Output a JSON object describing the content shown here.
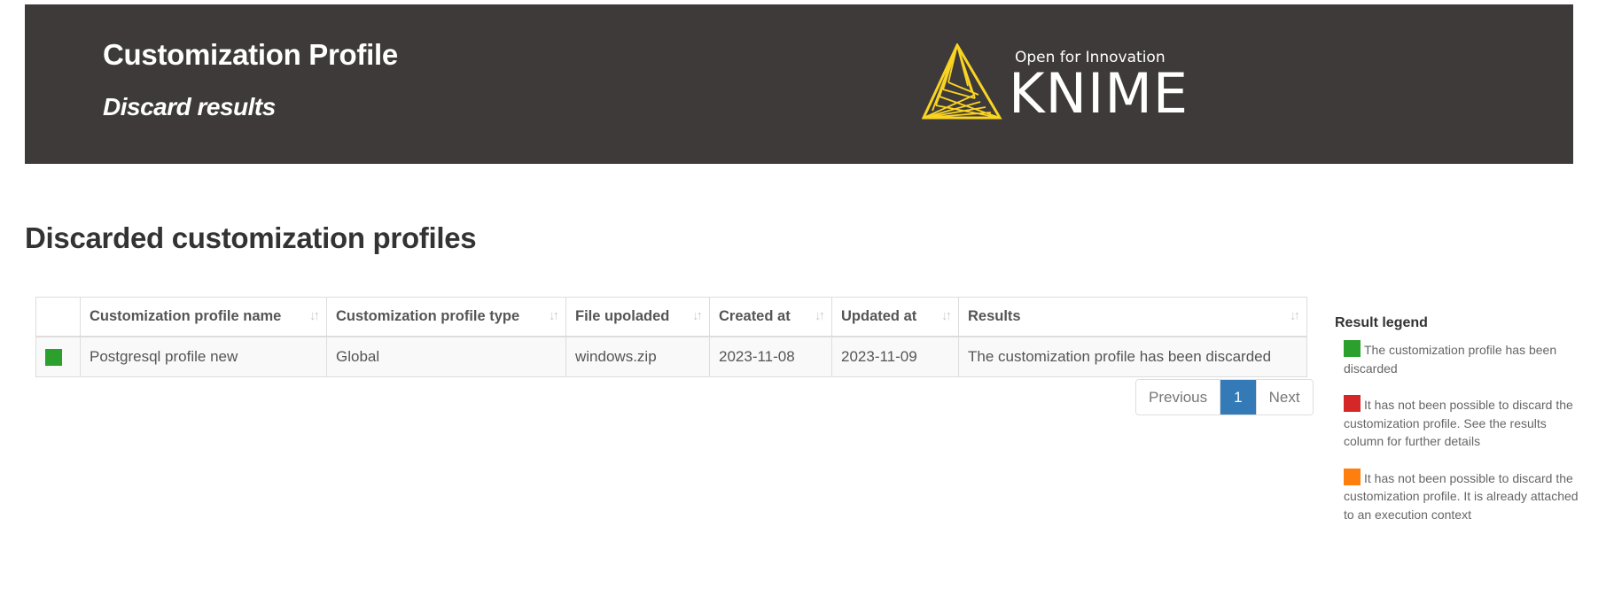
{
  "header": {
    "title": "Customization Profile",
    "subtitle": "Discard results",
    "logo": {
      "tagline": "Open for Innovation",
      "wordmark": "KNIME",
      "icon": "knime-triangle-icon",
      "accent_color": "#f9d423"
    },
    "background_color": "#3e3a39"
  },
  "section": {
    "title": "Discarded customization profiles"
  },
  "table": {
    "columns": [
      {
        "label": "",
        "sortable": false
      },
      {
        "label": "Customization profile name",
        "sortable": true
      },
      {
        "label": "Customization profile type",
        "sortable": true
      },
      {
        "label": "File upoladed",
        "sortable": true
      },
      {
        "label": "Created at",
        "sortable": true
      },
      {
        "label": "Updated at",
        "sortable": true
      },
      {
        "label": "Results",
        "sortable": true
      }
    ],
    "sort_icon": "sort-icon",
    "rows": [
      {
        "status": "discarded",
        "status_color": "#2ca02c",
        "name": "Postgresql profile new",
        "type": "Global",
        "file": "windows.zip",
        "created_at": "2023-11-08",
        "updated_at": "2023-11-09",
        "result": "The customization profile has been discarded"
      }
    ]
  },
  "pagination": {
    "previous_label": "Previous",
    "current_page": "1",
    "next_label": "Next",
    "active_color": "#337ab7"
  },
  "legend": {
    "title": "Result legend",
    "items": [
      {
        "color": "#2ca02c",
        "text": "The customization profile has been discarded"
      },
      {
        "color": "#d62728",
        "text": "It has not been possible to discard the customization profile. See the results column for further details"
      },
      {
        "color": "#ff7f0e",
        "text": "It has not been possible to discard the customization profile. It is already attached to an execution context"
      }
    ]
  }
}
